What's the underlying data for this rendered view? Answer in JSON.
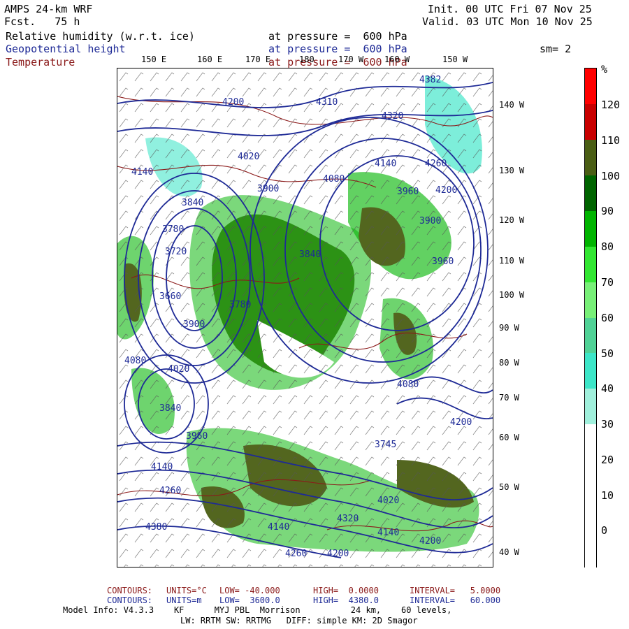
{
  "header": {
    "model": "AMPS 24-km WRF",
    "fcst": "Fcst.   75 h",
    "init": "Init. 00 UTC Fri 07 Nov 25",
    "valid": "Valid. 03 UTC Mon 10 Nov 25"
  },
  "fields": [
    {
      "name": "Relative humidity (w.r.t. ice)",
      "level": "at pressure =  600 hPa"
    },
    {
      "name": "Geopotential height",
      "level": "at pressure =  600 hPa"
    },
    {
      "name": "Temperature",
      "level": "at pressure =  600 hPa"
    }
  ],
  "smoothing": "sm= 2",
  "lon_labels": [
    "150 E",
    "160 E",
    "170 E",
    "180",
    "170 W",
    "160 W",
    "150 W"
  ],
  "lat_labels": [
    "140 W",
    "130 W",
    "120 W",
    "110 W",
    "100 W",
    "90 W",
    "80 W",
    "70 W",
    "60 W",
    "50 W",
    "40 W"
  ],
  "height_labels": [
    "4382",
    "4310",
    "4200",
    "4320",
    "4140",
    "4260",
    "4200",
    "4020",
    "4080",
    "3960",
    "4140",
    "3900",
    "3840",
    "3780",
    "3720",
    "3660",
    "3780",
    "3900",
    "4080",
    "4020",
    "3840",
    "3960",
    "4080",
    "3900",
    "3960",
    "3840",
    "4140",
    "4260",
    "4200",
    "4380",
    "4140",
    "4260",
    "4200",
    "4020",
    "4140",
    "4320",
    "3745",
    "4200"
  ],
  "colorbar": {
    "unit": "%",
    "labels": [
      "120",
      "110",
      "100",
      "90",
      "80",
      "70",
      "60",
      "50",
      "40",
      "30",
      "20",
      "10",
      "0"
    ],
    "colors": [
      "#ff0000",
      "#c80000",
      "#4a5e14",
      "#006400",
      "#00b400",
      "#32e632",
      "#78f078",
      "#50d296",
      "#3ce6c8",
      "#a0f0dc",
      "#ffffff",
      "#ffffff",
      "#ffffff",
      "#ffffff"
    ]
  },
  "footer": {
    "line1_label": "CONTOURS:",
    "line1_units": "UNITS=°C",
    "line1_low": "LOW= -40.000",
    "line1_high": "HIGH=  0.0000",
    "line1_interval": "INTERVAL=   5.0000",
    "line2_label": "CONTOURS:",
    "line2_units": "UNITS=m",
    "line2_low": "LOW=  3600.0",
    "line2_high": "HIGH=  4380.0",
    "line2_interval": "INTERVAL=   60.000",
    "line3": "Model Info: V4.3.3    KF      MYJ PBL  Morrison          24 km,    60 levels,",
    "line4": "LW: RRTM SW: RRTMG   DIFF: simple KM: 2D Smagor"
  }
}
